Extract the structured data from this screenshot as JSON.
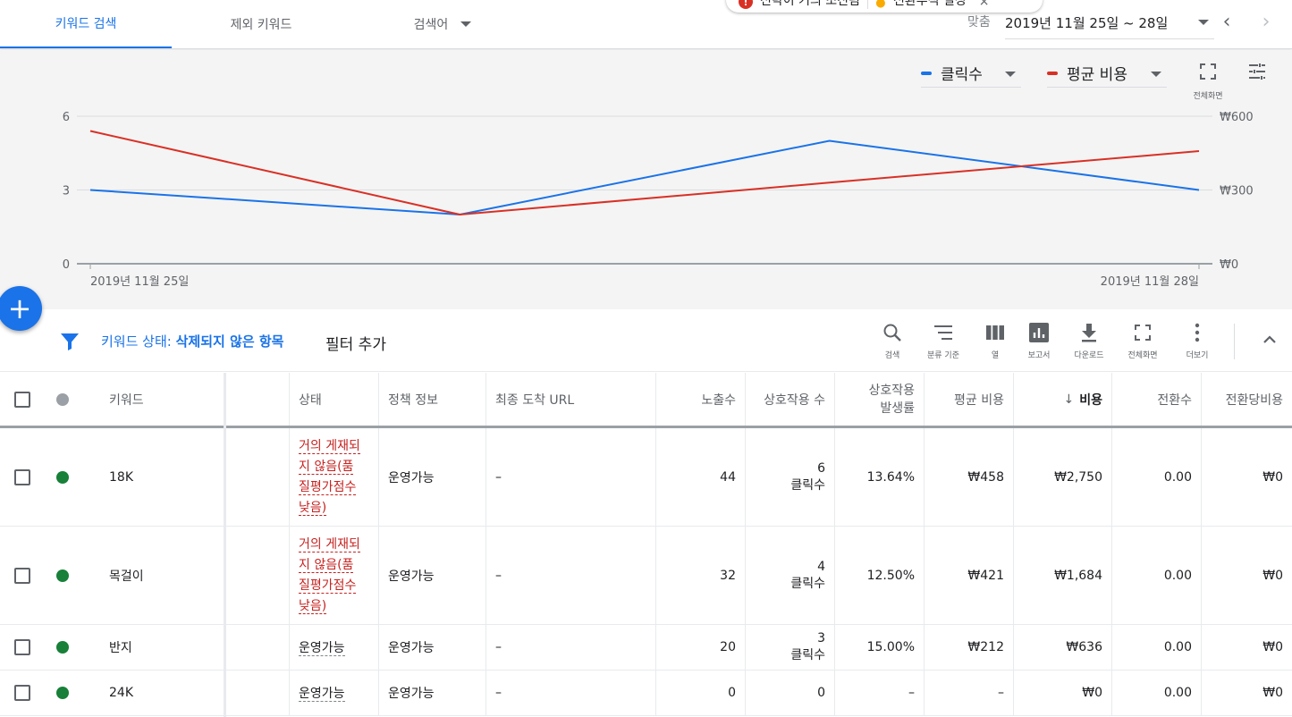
{
  "tabs": [
    "키워드 검색",
    "제외 키워드",
    "검색어"
  ],
  "notification": {
    "part1": "전략이 거의 조진됨",
    "part2": "전환추적 설정",
    "close": "×"
  },
  "date": {
    "label": "맞춤",
    "range": "2019년 11월 25일 ~ 28일",
    "prev": "‹",
    "next": "›"
  },
  "metric_selectors": [
    {
      "label": "클릭수",
      "color": "#1a73e8"
    },
    {
      "label": "평균 비용",
      "color": "#d93025"
    }
  ],
  "fullscreen_label": "전체화면",
  "chart_data": {
    "type": "line",
    "x": [
      "2019년 11월 25일",
      "",
      "",
      "2019년 11월 28일"
    ],
    "series": [
      {
        "name": "클릭수",
        "values": [
          3,
          2,
          5,
          3
        ],
        "color": "#1a73e8",
        "axis": "left"
      },
      {
        "name": "평균 비용",
        "values": [
          540,
          200,
          330,
          458
        ],
        "color": "#d93025",
        "axis": "right"
      }
    ],
    "y_left": {
      "ticks": [
        "0",
        "3",
        "6"
      ],
      "lim": [
        0,
        6
      ]
    },
    "y_right": {
      "ticks": [
        "₩0",
        "₩300",
        "₩600"
      ],
      "lim": [
        0,
        600
      ]
    },
    "grid": true
  },
  "fab_label": "+",
  "filter": {
    "prefix": "키워드 상태: ",
    "value": "삭제되지 않은 항목",
    "add": "필터 추가"
  },
  "tools": [
    {
      "label": "검색",
      "icon": "search-icon"
    },
    {
      "label": "분류 기준",
      "icon": "segment-icon"
    },
    {
      "label": "열",
      "icon": "columns-icon"
    },
    {
      "label": "보고서",
      "icon": "reports-icon"
    },
    {
      "label": "다운로드",
      "icon": "download-icon"
    },
    {
      "label": "전체화면",
      "icon": "fullscreen-icon"
    },
    {
      "label": "더보기",
      "icon": "more-vert-icon"
    }
  ],
  "columns": {
    "keyword": "키워드",
    "status": "상태",
    "policy": "정책 정보",
    "final_url": "최종 도착 URL",
    "impressions": "노출수",
    "interactions": "상호작용 수",
    "interaction_rate": "상호작용\n발생률",
    "avg_cost": "평균 비용",
    "cost": "비용",
    "conversions": "전환수",
    "cost_per_conv": "전환당비용"
  },
  "sort_arrow": "↓",
  "rows": [
    {
      "keyword": "18K",
      "status": "거의 게재되지 않음(품질평가점수 낮음)",
      "status_lines": [
        "거의 게재되",
        "지 않음(품",
        "질평가점수",
        "낮음)"
      ],
      "status_type": "bad",
      "policy": "운영가능",
      "final_url": "–",
      "impressions": "44",
      "interactions": "6",
      "interactions_unit": "클릭수",
      "interaction_rate": "13.64%",
      "avg_cost": "₩458",
      "cost": "₩2,750",
      "conversions": "0.00",
      "cost_per_conv": "₩0"
    },
    {
      "keyword": "목걸이",
      "status": "거의 게재되지 않음(품질평가점수 낮음)",
      "status_lines": [
        "거의 게재되",
        "지 않음(품",
        "질평가점수",
        "낮음)"
      ],
      "status_type": "bad",
      "policy": "운영가능",
      "final_url": "–",
      "impressions": "32",
      "interactions": "4",
      "interactions_unit": "클릭수",
      "interaction_rate": "12.50%",
      "avg_cost": "₩421",
      "cost": "₩1,684",
      "conversions": "0.00",
      "cost_per_conv": "₩0"
    },
    {
      "keyword": "반지",
      "status": "운영가능",
      "status_lines": [
        "운영가능"
      ],
      "status_type": "ok",
      "policy": "운영가능",
      "final_url": "–",
      "impressions": "20",
      "interactions": "3",
      "interactions_unit": "클릭수",
      "interaction_rate": "15.00%",
      "avg_cost": "₩212",
      "cost": "₩636",
      "conversions": "0.00",
      "cost_per_conv": "₩0"
    },
    {
      "keyword": "24K",
      "status": "운영가능",
      "status_lines": [
        "운영가능"
      ],
      "status_type": "ok",
      "policy": "운영가능",
      "final_url": "–",
      "impressions": "0",
      "interactions": "0",
      "interactions_unit": "",
      "interaction_rate": "–",
      "avg_cost": "–",
      "cost": "₩0",
      "conversions": "0.00",
      "cost_per_conv": "₩0"
    }
  ]
}
